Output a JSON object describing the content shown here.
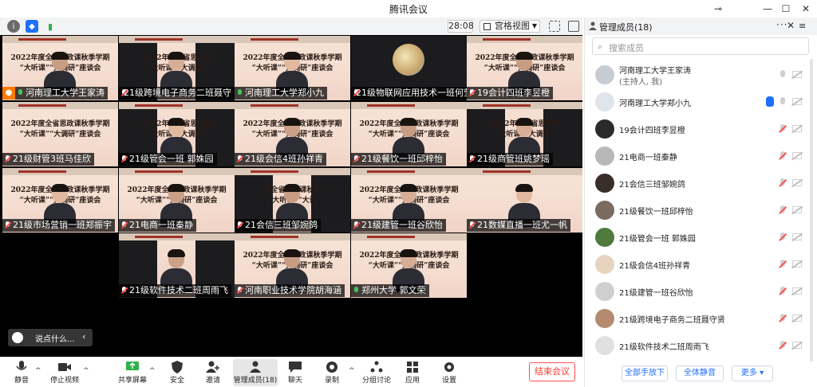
{
  "window": {
    "title": "腾讯会议",
    "pin": "⊸",
    "minimize": "—",
    "maximize": "☐",
    "close": "✕"
  },
  "topbar": {
    "timer": "28:08",
    "view_label": "宫格视图"
  },
  "tiles": [
    {
      "name": "河南理工大学王家涛",
      "kind": "slide-person",
      "host": true,
      "mic": "on",
      "line1": "2022年度全省思政课秋季学期",
      "line2": "“大听课”“大调研”座谈会"
    },
    {
      "name": "21级跨境电子商务二班聂守",
      "kind": "narrow",
      "mic": "muted",
      "line1": "2022年度全省思政课",
      "line2": "“大听课”“大调研”"
    },
    {
      "name": "河南理工大学郑小九",
      "kind": "slide-person",
      "mic": "on",
      "line1": "2022年度全省思政课秋季学期",
      "line2": "“大听课”“大调研”座谈会"
    },
    {
      "name": "21级物联网应用技术一班何莹",
      "kind": "avatar",
      "mic": "muted",
      "line1": "",
      "line2": ""
    },
    {
      "name": "19会计四班李昱橙",
      "kind": "slide-person",
      "mic": "muted",
      "line1": "2022年度全省思政课秋季学期",
      "line2": "“大听课”“大调研”座谈会"
    },
    {
      "name": "21级财管3班马佳欣",
      "kind": "slide",
      "mic": "muted",
      "line1": "2022年度全省思政课秋季学期",
      "line2": "“大听课”“大调研”座谈会"
    },
    {
      "name": "21级管会一班 郭姝园",
      "kind": "narrow",
      "mic": "muted",
      "line1": "2022年度全省思政课",
      "line2": "“大听课”“大调研”"
    },
    {
      "name": "21级会信4班孙祥青",
      "kind": "slide-person",
      "mic": "muted",
      "line1": "2022年度全省思政课秋季学期",
      "line2": "“大听课”“大调研”座谈会"
    },
    {
      "name": "21级餐饮一班邱梓怡",
      "kind": "slide-person",
      "mic": "muted",
      "line1": "2022年度全省思政课秋季学期",
      "line2": "“大听课”“大调研”座谈会"
    },
    {
      "name": "21级商管班姚梦瑶",
      "kind": "narrow",
      "mic": "muted",
      "line1": "2022年度全省思政课",
      "line2": "“大听课”“大调研”"
    },
    {
      "name": "21级市场营销一班郑振宇",
      "kind": "slide-person",
      "mic": "muted",
      "line1": "2022年度全省思政课秋季学期",
      "line2": "“大听课”“大调研”座谈会"
    },
    {
      "name": "21电商一班秦静",
      "kind": "slide-person",
      "mic": "muted",
      "line1": "2022年度全省思政课秋季学期",
      "line2": "“大听课”“大调研”座谈会"
    },
    {
      "name": "21会信三班邹婉鸽",
      "kind": "narrow",
      "mic": "muted",
      "line1": "度全省思政课秋季",
      "line2": "“大听课”“大调"
    },
    {
      "name": "21级建管一班谷欣怡",
      "kind": "slide-person",
      "mic": "muted",
      "line1": "2022年度全省思政课秋季学期",
      "line2": "“大听课”“大调研”座谈会"
    },
    {
      "name": "21数媒直播一班尤一帆",
      "kind": "slide-person",
      "mic": "muted",
      "line1": "",
      "line2": ""
    },
    {
      "name": "21级软件技术二班周雨飞",
      "kind": "narrow",
      "mic": "muted",
      "line1": "",
      "line2": ""
    },
    {
      "name": "河南职业技术学院胡海涵",
      "kind": "slide-person",
      "mic": "muted",
      "line1": "2022年度全省思政课秋季学期",
      "line2": "“大听课”“大调研”座谈会"
    },
    {
      "name": "郑州大学 郭文荣",
      "kind": "slide-person",
      "mic": "on",
      "line1": "2022年度全省思政课秋季学期",
      "line2": "“大听课”“大调研”座谈会"
    }
  ],
  "chat": {
    "placeholder": "说点什么...",
    "collapse": "‹"
  },
  "toolbar": [
    {
      "label": "静音",
      "icon": "mic-icon"
    },
    {
      "label": "停止视频",
      "icon": "video-icon"
    },
    {
      "label": "共享屏幕",
      "icon": "share-screen-icon"
    },
    {
      "label": "安全",
      "icon": "shield-icon"
    },
    {
      "label": "邀请",
      "icon": "invite-icon"
    },
    {
      "label": "管理成员(18)",
      "icon": "members-icon"
    },
    {
      "label": "聊天",
      "icon": "chat-icon"
    },
    {
      "label": "录制",
      "icon": "record-icon"
    },
    {
      "label": "分组讨论",
      "icon": "breakout-icon"
    },
    {
      "label": "应用",
      "icon": "apps-icon"
    },
    {
      "label": "设置",
      "icon": "settings-icon"
    }
  ],
  "end_label": "结束会议",
  "panel": {
    "title": "管理成员(18)",
    "search_placeholder": "搜索成员",
    "members": [
      {
        "name": "河南理工大学王家涛",
        "sub": "(主持人, 我)",
        "mic": "on"
      },
      {
        "name": "河南理工大学郑小九",
        "mic": "on",
        "hand": true
      },
      {
        "name": "19会计四班李昱橙",
        "mic": "muted"
      },
      {
        "name": "21电商一班秦静",
        "mic": "muted"
      },
      {
        "name": "21会信三班邹婉鸽",
        "mic": "muted"
      },
      {
        "name": "21级餐饮一班邱梓怡",
        "mic": "muted"
      },
      {
        "name": "21级管会一班 郭姝园",
        "mic": "muted"
      },
      {
        "name": "21级会信4班孙祥青",
        "mic": "muted"
      },
      {
        "name": "21级建管一班谷欣怡",
        "mic": "muted"
      },
      {
        "name": "21级跨境电子商务二班聂守贤",
        "mic": "muted"
      },
      {
        "name": "21级软件技术二班周雨飞",
        "mic": "muted"
      }
    ],
    "buttons": [
      "全部手放下",
      "全体静音",
      "更多 ▾"
    ]
  },
  "colors": {
    "accent": "#1e6fff",
    "end": "#ff3b30",
    "muted": "#ff4d4f",
    "host": "#ff7a00"
  }
}
